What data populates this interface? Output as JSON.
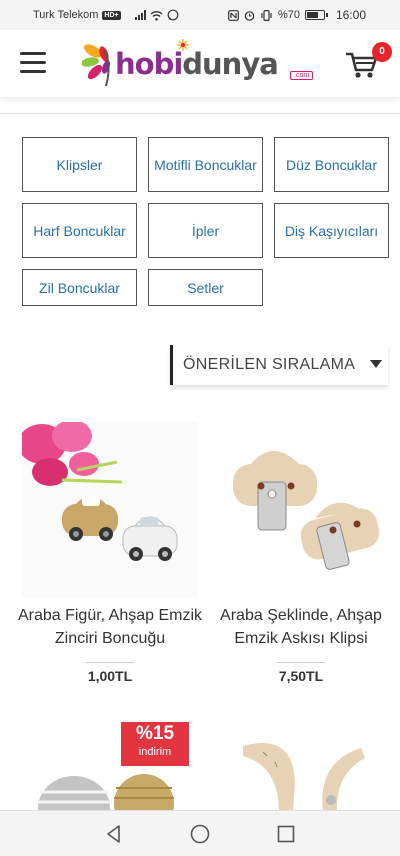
{
  "status_bar": {
    "carrier": "Turk Telekom",
    "hd": "HD+",
    "battery": "%70",
    "battery_level": 0.7,
    "time": "16:00"
  },
  "header": {
    "logo_main": "hobi",
    "logo_accent": "dunya",
    "logo_suffix": ".com",
    "cart_count": "0"
  },
  "categories": [
    "Klipsler",
    "Motifli Boncuklar",
    "Düz Boncuklar",
    "Harf Boncuklar",
    "İpler",
    "Diş Kaşıyıcıları",
    "Zil Boncuklar",
    "Setler"
  ],
  "sort": {
    "label": "ÖNERİLEN SIRALAMA"
  },
  "products": [
    {
      "name": "Araba Figür, Ahşap Emzik Zinciri Boncuğu",
      "price": "1,00TL"
    },
    {
      "name": "Araba Şeklinde, Ahşap Emzik Askısı Klipsi",
      "price": "7,50TL"
    },
    {
      "discount_pct": "%15",
      "discount_label": "indirim"
    },
    {}
  ],
  "colors": {
    "category_text": "#2a6fb0",
    "cart_badge": "#e8232a",
    "discount_badge": "#e33540",
    "logo_purple": "#8b2f8e"
  },
  "icons": [
    "menu-icon",
    "cart-icon",
    "back-icon",
    "home-icon",
    "recents-icon"
  ]
}
